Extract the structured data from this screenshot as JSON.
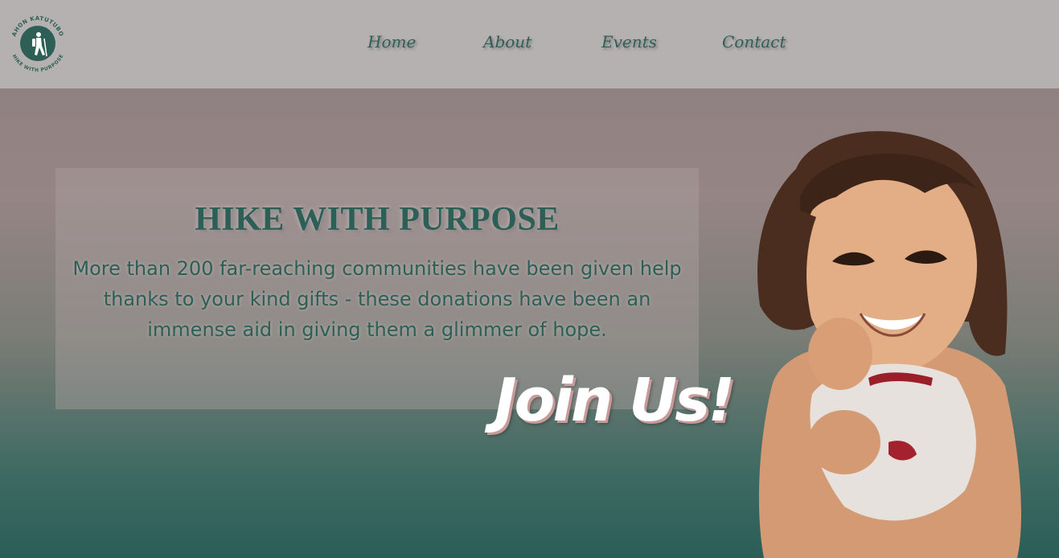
{
  "header": {
    "logo": {
      "top_text": "AHON KATUTUBO",
      "bottom_text": "HIKE WITH PURPOSE",
      "icon": "hiker-icon"
    },
    "nav": [
      {
        "label": "Home"
      },
      {
        "label": "About"
      },
      {
        "label": "Events"
      },
      {
        "label": "Contact"
      }
    ]
  },
  "hero": {
    "title": "HIKE WITH PURPOSE",
    "text": "More than 200 far-reaching communities have been given help thanks to your kind gifts - these donations have been an immense aid in giving them a glimmer of hope.",
    "cta": "Join Us!",
    "image": "smiling-child-photo"
  },
  "colors": {
    "header_bg": "#b5b1b1",
    "brand_green": "#2d5f57",
    "cta_shadow": "#c89a9a"
  }
}
